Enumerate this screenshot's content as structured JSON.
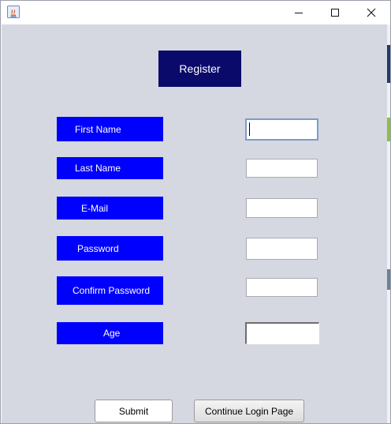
{
  "window": {
    "minimize_glyph": "─",
    "maximize_glyph": "☐",
    "close_glyph": "✕",
    "app_icon": "java-icon"
  },
  "header": {
    "title": "Register"
  },
  "form": {
    "fields": [
      {
        "label": "First Name",
        "value": "",
        "focused": true
      },
      {
        "label": "Last Name",
        "value": ""
      },
      {
        "label": "E-Mail",
        "value": ""
      },
      {
        "label": "Password",
        "value": ""
      },
      {
        "label": "Confirm Password",
        "value": ""
      },
      {
        "label": "Age",
        "value": ""
      }
    ]
  },
  "buttons": {
    "submit_label": "Submit",
    "continue_label": "Continue Login Page"
  },
  "colors": {
    "background": "#d5d8e0",
    "header_bg": "#0a0a6b",
    "label_bg": "#0000ff",
    "label_text": "#ffffff"
  }
}
